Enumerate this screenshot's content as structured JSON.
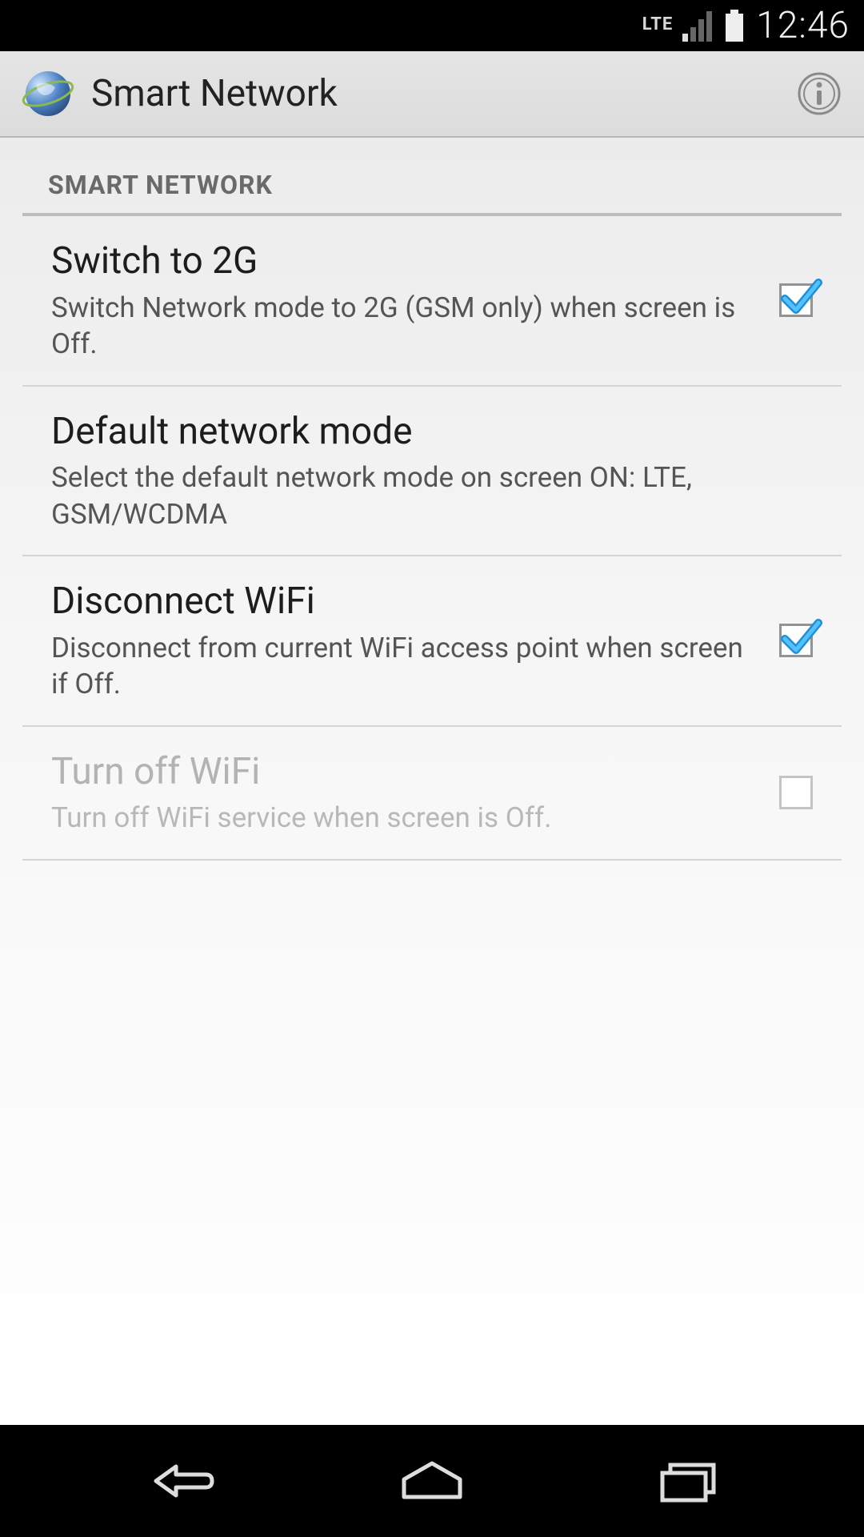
{
  "statusbar": {
    "network_label": "LTE",
    "time": "12:46"
  },
  "actionbar": {
    "title": "Smart Network"
  },
  "section": {
    "header": "SMART NETWORK"
  },
  "prefs": {
    "switch2g": {
      "title": "Switch to 2G",
      "summary": "Switch Network mode to 2G (GSM only) when screen is Off.",
      "checked": true,
      "enabled": true
    },
    "defaultmode": {
      "title": "Default network mode",
      "summary": "Select the default network mode on screen ON: LTE, GSM/WCDMA",
      "enabled": true
    },
    "disconnectwifi": {
      "title": "Disconnect WiFi",
      "summary": "Disconnect from current WiFi access point when screen if Off.",
      "checked": true,
      "enabled": true
    },
    "turnoffwifi": {
      "title": "Turn off WiFi",
      "summary": "Turn off WiFi service when screen is Off.",
      "checked": false,
      "enabled": false
    }
  }
}
